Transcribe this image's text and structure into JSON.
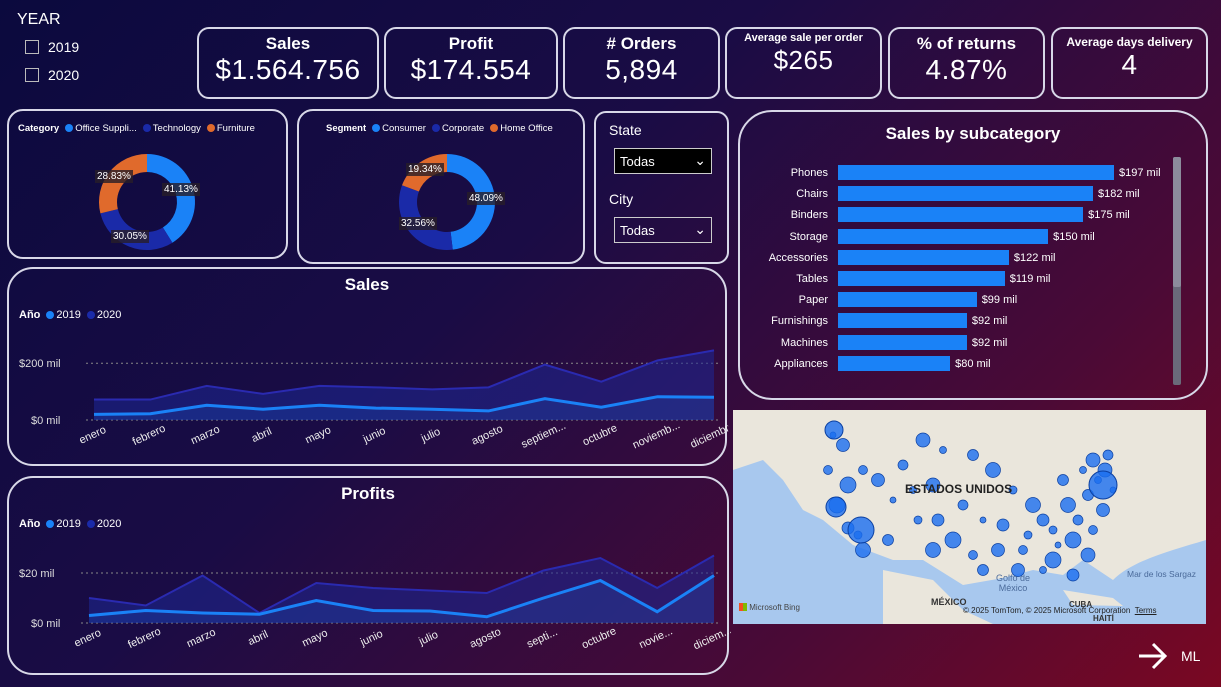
{
  "year_slicer": {
    "title": "YEAR",
    "options": [
      "2019",
      "2020"
    ]
  },
  "kpis": [
    {
      "title": "Sales",
      "value": "$1.564.756"
    },
    {
      "title": "Profit",
      "value": "$174.554"
    },
    {
      "title": "# Orders",
      "value": "5,894"
    },
    {
      "title": "Average sale per order",
      "value": "$265"
    },
    {
      "title": "% of returns",
      "value": "4.87%"
    },
    {
      "title": "Average days delivery",
      "value": "4"
    }
  ],
  "category_donut": {
    "legend_title": "Category",
    "items": [
      "Office Suppli...",
      "Technology",
      "Furniture"
    ],
    "labels": [
      "41.13%",
      "30.05%",
      "28.83%"
    ]
  },
  "segment_donut": {
    "legend_title": "Segment",
    "items": [
      "Consumer",
      "Corporate",
      "Home Office"
    ],
    "labels": [
      "48.09%",
      "32.56%",
      "19.34%"
    ]
  },
  "filters": {
    "state_label": "State",
    "state_value": "Todas",
    "city_label": "City",
    "city_value": "Todas"
  },
  "colors": {
    "c1": "#1a82f7",
    "c2": "#1a2aa8",
    "c3": "#e06a2c",
    "accent": "#1a82f7"
  },
  "chart_data": [
    {
      "type": "bar",
      "title": "Sales by subcategory",
      "categories": [
        "Phones",
        "Chairs",
        "Binders",
        "Storage",
        "Accessories",
        "Tables",
        "Paper",
        "Furnishings",
        "Machines",
        "Appliances"
      ],
      "values": [
        197,
        182,
        175,
        150,
        122,
        119,
        99,
        92,
        92,
        80
      ],
      "value_labels": [
        "$197 mil",
        "$182 mil",
        "$175 mil",
        "$150 mil",
        "$122 mil",
        "$119 mil",
        "$99 mil",
        "$92 mil",
        "$92 mil",
        "$80 mil"
      ]
    },
    {
      "type": "area",
      "title": "Sales",
      "legend_title": "Año",
      "x": [
        "enero",
        "febrero",
        "marzo",
        "abril",
        "mayo",
        "junio",
        "julio",
        "agosto",
        "septiem...",
        "octubre",
        "noviemb...",
        "diciembre"
      ],
      "y_ticks": [
        "$200 mil",
        "$0 mil"
      ],
      "ylim": [
        0,
        250
      ],
      "series": [
        {
          "name": "2019",
          "values": [
            20,
            22,
            52,
            38,
            52,
            42,
            38,
            32,
            75,
            45,
            82,
            80
          ]
        },
        {
          "name": "2020",
          "values": [
            72,
            72,
            120,
            92,
            120,
            115,
            108,
            115,
            195,
            135,
            210,
            245
          ]
        }
      ]
    },
    {
      "type": "area",
      "title": "Profits",
      "legend_title": "Año",
      "x": [
        "enero",
        "febrero",
        "marzo",
        "abril",
        "mayo",
        "junio",
        "julio",
        "agosto",
        "septi...",
        "octubre",
        "novie...",
        "diciem..."
      ],
      "y_ticks": [
        "$20 mil",
        "$0 mil"
      ],
      "ylim": [
        0,
        30
      ],
      "series": [
        {
          "name": "2019",
          "values": [
            3,
            5,
            4,
            3.5,
            9,
            5,
            4.8,
            2.5,
            10,
            17,
            4.5,
            19
          ]
        },
        {
          "name": "2020",
          "values": [
            10,
            7,
            19,
            4,
            16,
            14,
            13,
            12,
            21,
            26,
            14,
            27
          ]
        }
      ]
    }
  ],
  "map": {
    "country_label": "ESTADOS UNIDOS",
    "labels": [
      "Golfo de México",
      "MÉXICO",
      "CUBA",
      "HAITÍ",
      "Mar de los Sargaz"
    ],
    "brand": "Microsoft Bing",
    "copyright": "© 2025 TomTom, © 2025 Microsoft Corporation",
    "terms": "Terms"
  },
  "nav": {
    "ml_label": "ML"
  }
}
